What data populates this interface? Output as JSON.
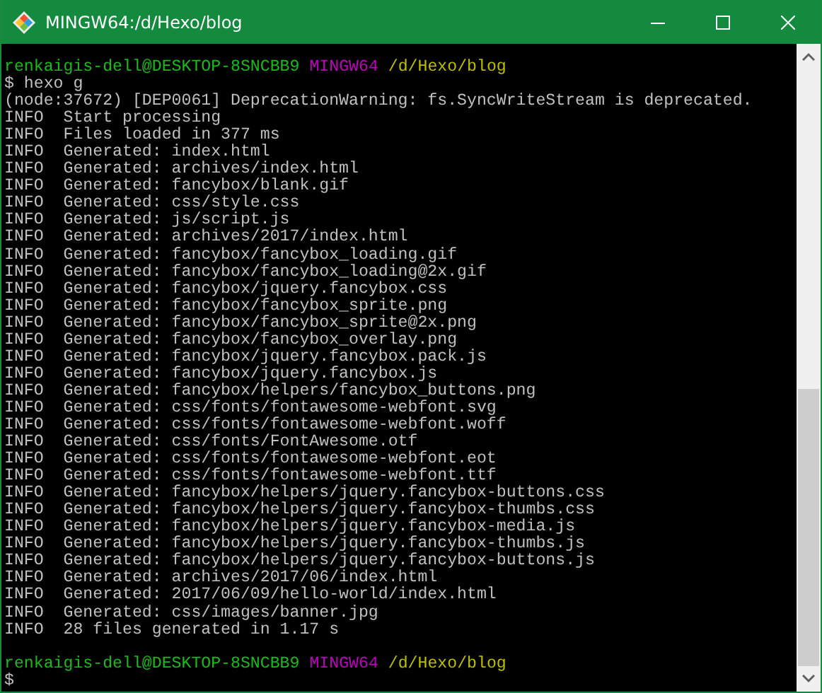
{
  "window": {
    "title": "MINGW64:/d/Hexo/blog"
  },
  "terminal": {
    "lines": [
      {
        "kind": "prompt",
        "user_host": "renkaigis-dell@DESKTOP-8SNCBB9",
        "shell": "MINGW64",
        "path": "/d/Hexo/blog"
      },
      {
        "kind": "command",
        "text": "$ hexo g"
      },
      {
        "kind": "output",
        "text": "(node:37672) [DEP0061] DeprecationWarning: fs.SyncWriteStream is deprecated."
      },
      {
        "kind": "output",
        "text": "INFO  Start processing"
      },
      {
        "kind": "output",
        "text": "INFO  Files loaded in 377 ms"
      },
      {
        "kind": "output",
        "text": "INFO  Generated: index.html"
      },
      {
        "kind": "output",
        "text": "INFO  Generated: archives/index.html"
      },
      {
        "kind": "output",
        "text": "INFO  Generated: fancybox/blank.gif"
      },
      {
        "kind": "output",
        "text": "INFO  Generated: css/style.css"
      },
      {
        "kind": "output",
        "text": "INFO  Generated: js/script.js"
      },
      {
        "kind": "output",
        "text": "INFO  Generated: archives/2017/index.html"
      },
      {
        "kind": "output",
        "text": "INFO  Generated: fancybox/fancybox_loading.gif"
      },
      {
        "kind": "output",
        "text": "INFO  Generated: fancybox/fancybox_loading@2x.gif"
      },
      {
        "kind": "output",
        "text": "INFO  Generated: fancybox/jquery.fancybox.css"
      },
      {
        "kind": "output",
        "text": "INFO  Generated: fancybox/fancybox_sprite.png"
      },
      {
        "kind": "output",
        "text": "INFO  Generated: fancybox/fancybox_sprite@2x.png"
      },
      {
        "kind": "output",
        "text": "INFO  Generated: fancybox/fancybox_overlay.png"
      },
      {
        "kind": "output",
        "text": "INFO  Generated: fancybox/jquery.fancybox.pack.js"
      },
      {
        "kind": "output",
        "text": "INFO  Generated: fancybox/jquery.fancybox.js"
      },
      {
        "kind": "output",
        "text": "INFO  Generated: fancybox/helpers/fancybox_buttons.png"
      },
      {
        "kind": "output",
        "text": "INFO  Generated: css/fonts/fontawesome-webfont.svg"
      },
      {
        "kind": "output",
        "text": "INFO  Generated: css/fonts/fontawesome-webfont.woff"
      },
      {
        "kind": "output",
        "text": "INFO  Generated: css/fonts/FontAwesome.otf"
      },
      {
        "kind": "output",
        "text": "INFO  Generated: css/fonts/fontawesome-webfont.eot"
      },
      {
        "kind": "output",
        "text": "INFO  Generated: css/fonts/fontawesome-webfont.ttf"
      },
      {
        "kind": "output",
        "text": "INFO  Generated: fancybox/helpers/jquery.fancybox-buttons.css"
      },
      {
        "kind": "output",
        "text": "INFO  Generated: fancybox/helpers/jquery.fancybox-thumbs.css"
      },
      {
        "kind": "output",
        "text": "INFO  Generated: fancybox/helpers/jquery.fancybox-media.js"
      },
      {
        "kind": "output",
        "text": "INFO  Generated: fancybox/helpers/jquery.fancybox-thumbs.js"
      },
      {
        "kind": "output",
        "text": "INFO  Generated: fancybox/helpers/jquery.fancybox-buttons.js"
      },
      {
        "kind": "output",
        "text": "INFO  Generated: archives/2017/06/index.html"
      },
      {
        "kind": "output",
        "text": "INFO  Generated: 2017/06/09/hello-world/index.html"
      },
      {
        "kind": "output",
        "text": "INFO  Generated: css/images/banner.jpg"
      },
      {
        "kind": "output",
        "text": "INFO  28 files generated in 1.17 s"
      },
      {
        "kind": "blank"
      },
      {
        "kind": "prompt",
        "user_host": "renkaigis-dell@DESKTOP-8SNCBB9",
        "shell": "MINGW64",
        "path": "/d/Hexo/blog"
      },
      {
        "kind": "command",
        "text": "$"
      }
    ]
  }
}
